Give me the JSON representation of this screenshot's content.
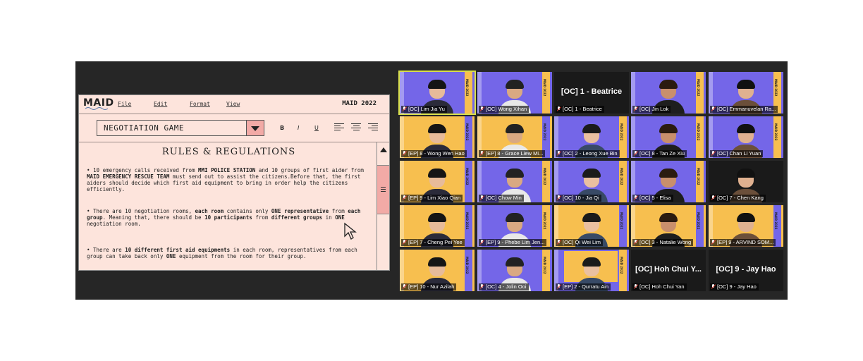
{
  "document": {
    "logo": "MAID",
    "menu": [
      "File",
      "Edit",
      "Format",
      "View"
    ],
    "brand": "MAID 2022",
    "heading_select": "NEGOTIATION GAME",
    "toolbar": {
      "bold": "B",
      "italic": "I",
      "underline": "U"
    },
    "title": "RULES & REGULATIONS",
    "bullets": [
      {
        "parts": [
          {
            "t": "10 emergency calls received from ",
            "b": false
          },
          {
            "t": "MMI POLICE STATION",
            "b": true
          },
          {
            "t": " and 10 groups of first aider from ",
            "b": false
          },
          {
            "t": "MAID EMERGENCY RESCUE TEAM",
            "b": true
          },
          {
            "t": " must send out to assist the citizens.Before that, the first aiders should decide which first aid equipment to bring in order help the citizens efficiently.",
            "b": false
          }
        ]
      },
      {
        "parts": [
          {
            "t": "There are 10 negotiation rooms, ",
            "b": false
          },
          {
            "t": "each room",
            "b": true
          },
          {
            "t": " contains only ",
            "b": false
          },
          {
            "t": "ONE representative",
            "b": true
          },
          {
            "t": " from ",
            "b": false
          },
          {
            "t": "each group",
            "b": true
          },
          {
            "t": ". Meaning that, there should be ",
            "b": false
          },
          {
            "t": "10 participants",
            "b": true
          },
          {
            "t": " from ",
            "b": false
          },
          {
            "t": "different groups",
            "b": true
          },
          {
            "t": " in ",
            "b": false
          },
          {
            "t": "ONE",
            "b": true
          },
          {
            "t": " negotiation room.",
            "b": false
          }
        ]
      },
      {
        "parts": [
          {
            "t": "There are ",
            "b": false
          },
          {
            "t": "10 different first aid equipments",
            "b": true
          },
          {
            "t": " in each room, representatives from each group can take back only ",
            "b": false
          },
          {
            "t": "ONE",
            "b": true
          },
          {
            "t": " equipment from the room for their group.",
            "b": false
          }
        ]
      }
    ]
  },
  "gallery": {
    "banner_text": "MAID 2022",
    "participants": [
      {
        "name": "[OC] Lim Jia Yu",
        "bg": "purple",
        "speaking": true,
        "muted": false
      },
      {
        "name": "[OC] Wong Xihan",
        "bg": "purple",
        "muted": true
      },
      {
        "name": "[OC] 1 - Beatrice",
        "bg": "blank",
        "big": "[OC] 1 - Beatrice",
        "muted": true
      },
      {
        "name": "[OC] Jin Lok",
        "bg": "purple",
        "muted": true
      },
      {
        "name": "[OC] Emmanuvelan Ra...",
        "bg": "purple",
        "muted": true
      },
      {
        "name": "[EP] 8 - Wong Wen Hao",
        "bg": "yellow",
        "muted": true
      },
      {
        "name": "[EP] 8 - Grace Liew Mi...",
        "bg": "yellow",
        "muted": true
      },
      {
        "name": "[OC] 2 - Leong Xue Bin",
        "bg": "purple",
        "muted": true
      },
      {
        "name": "[OC] 8 - Tan Ze Xiu",
        "bg": "purple",
        "muted": true
      },
      {
        "name": "[OC] Chan Li Yuan",
        "bg": "purple",
        "muted": true
      },
      {
        "name": "[EP] 9 - Lim Xiao Qian",
        "bg": "yellow",
        "muted": true
      },
      {
        "name": "[OC] Chow Min",
        "bg": "purple",
        "muted": true
      },
      {
        "name": "[OC] 10 - Jia Qi",
        "bg": "purple",
        "muted": true
      },
      {
        "name": "[OC] 5 - Elisa",
        "bg": "purple",
        "muted": true
      },
      {
        "name": "[OC] 7 - Chen Kang",
        "bg": "dark",
        "muted": true
      },
      {
        "name": "[EP] 7 - Cheng Pei Yee",
        "bg": "yellow",
        "muted": true
      },
      {
        "name": "[EP] 9 - Phebe Lim Jen...",
        "bg": "purple",
        "muted": true
      },
      {
        "name": "[OC] Qi Wei Lim",
        "bg": "yellow",
        "muted": true
      },
      {
        "name": "[OC] 3 - Natalie Wong",
        "bg": "yellow",
        "muted": true
      },
      {
        "name": "[EP] 9 - ARVIND SOM...",
        "bg": "yellow",
        "muted": true
      },
      {
        "name": "[EP] 10 - Nur Azilah",
        "bg": "yellow",
        "muted": true
      },
      {
        "name": "[OC] 4 - Jolin Ooi",
        "bg": "purple",
        "muted": true
      },
      {
        "name": "[EP] 2 - Qurratu Ain",
        "bg": "inset",
        "muted": true
      },
      {
        "name": "[OC] Hoh Chui Yan",
        "bg": "blank",
        "big": "[OC] Hoh Chui Y...",
        "muted": true
      },
      {
        "name": "[OC] 9 - Jay Hao",
        "bg": "blank",
        "big": "[OC] 9 - Jay Hao",
        "muted": true
      }
    ]
  }
}
